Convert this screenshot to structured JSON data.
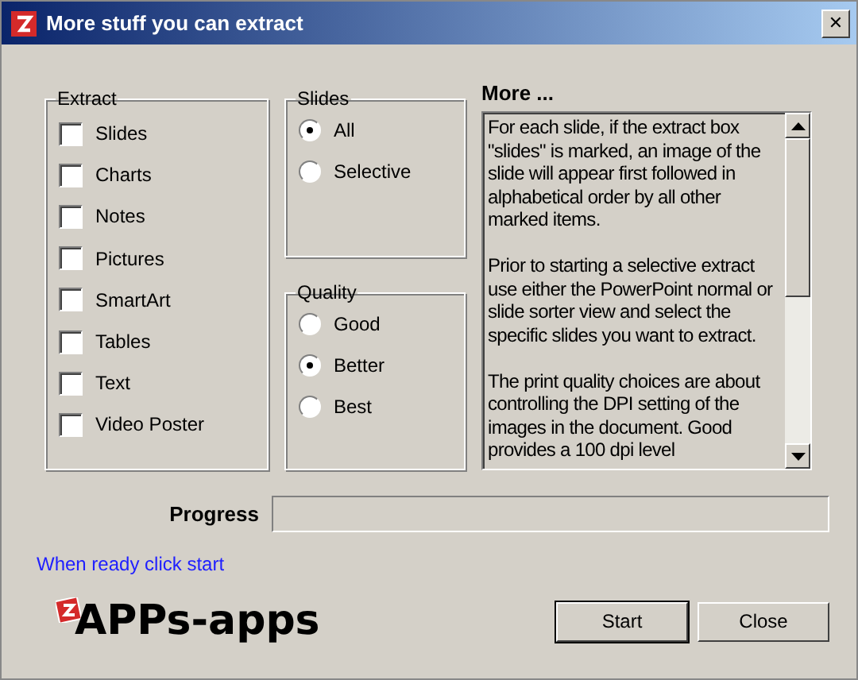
{
  "window": {
    "title": "More stuff you can extract",
    "close": "✕"
  },
  "extract": {
    "label": "Extract",
    "items": [
      {
        "label": "Slides",
        "checked": false
      },
      {
        "label": "Charts",
        "checked": false
      },
      {
        "label": "Notes",
        "checked": false
      },
      {
        "label": "Pictures",
        "checked": false
      },
      {
        "label": "SmartArt",
        "checked": false
      },
      {
        "label": "Tables",
        "checked": false
      },
      {
        "label": "Text",
        "checked": false
      },
      {
        "label": "Video Poster",
        "checked": false
      }
    ]
  },
  "slides": {
    "label": "Slides",
    "options": [
      {
        "label": "All",
        "selected": true
      },
      {
        "label": "Selective",
        "selected": false
      }
    ]
  },
  "quality": {
    "label": "Quality",
    "options": [
      {
        "label": "Good",
        "selected": false
      },
      {
        "label": "Better",
        "selected": true
      },
      {
        "label": "Best",
        "selected": false
      }
    ]
  },
  "more": {
    "label": "More ...",
    "paragraphs": [
      "For each slide, if the extract box \"slides\" is marked, an image of the slide will appear first followed in alphabetical order by all other marked items.",
      "Prior to starting a selective extract use either the PowerPoint normal or slide sorter view and select the specific slides you want to extract.",
      "The print quality choices are about controlling the DPI setting of the images in the document. Good provides a 100 dpi level"
    ]
  },
  "progress": {
    "label": "Progress",
    "level": 0
  },
  "hint": "When ready click start",
  "logo": "APPs-apps",
  "buttons": [
    "Start",
    "Close"
  ]
}
